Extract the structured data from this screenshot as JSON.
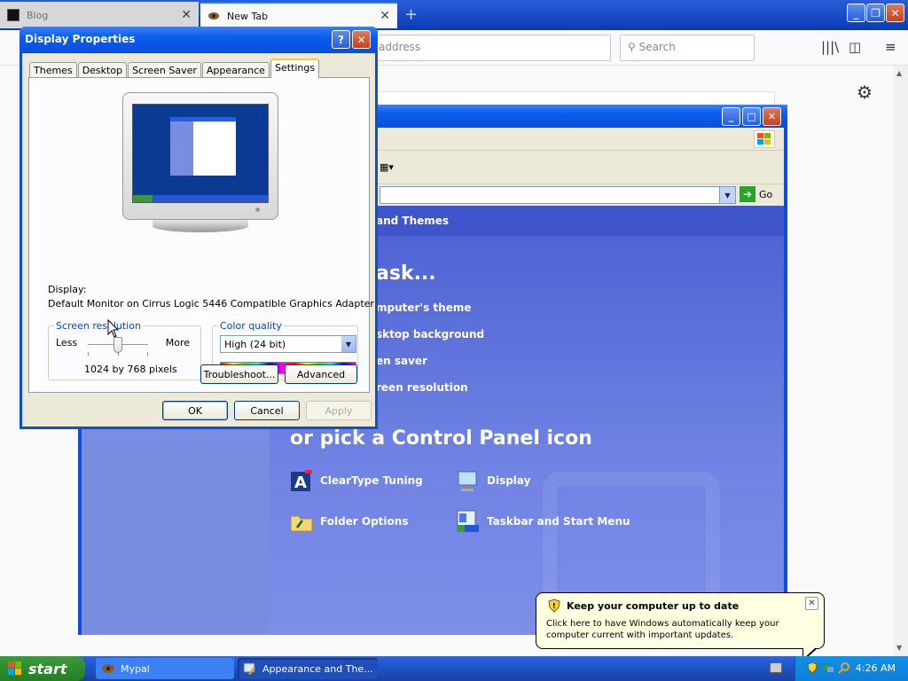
{
  "browser": {
    "tabs": [
      {
        "label": "Blog"
      },
      {
        "label": "New Tab"
      }
    ],
    "url_placeholder": "address",
    "search_placeholder": "Search"
  },
  "control_panel": {
    "breadcrumb": "and Themes",
    "pick_task": "ask...",
    "tasks": [
      {
        "label": "mputer's theme"
      },
      {
        "label": "sktop background"
      },
      {
        "label": "en saver"
      },
      {
        "label": "reen resolution"
      }
    ],
    "pick_icon": "or pick a Control Panel icon",
    "icons": [
      {
        "label": "ClearType Tuning",
        "icon": "cleartype-icon"
      },
      {
        "label": "Display",
        "icon": "display-icon"
      },
      {
        "label": "Folder Options",
        "icon": "folder-options-icon"
      },
      {
        "label": "Taskbar and Start Menu",
        "icon": "taskbar-icon"
      }
    ],
    "go_label": "Go"
  },
  "display_properties": {
    "title": "Display Properties",
    "tabs": [
      "Themes",
      "Desktop",
      "Screen Saver",
      "Appearance",
      "Settings"
    ],
    "active_tab": "Settings",
    "display_label": "Display:",
    "display_value": "Default Monitor on Cirrus Logic 5446 Compatible Graphics Adapter",
    "resolution": {
      "legend": "Screen resolution",
      "less": "Less",
      "more": "More",
      "value": "1024 by 768 pixels",
      "slider_position": 0.5
    },
    "color_quality": {
      "legend": "Color quality",
      "selected": "High (24 bit)"
    },
    "buttons": {
      "troubleshoot": "Troubleshoot...",
      "advanced": "Advanced",
      "ok": "OK",
      "cancel": "Cancel",
      "apply": "Apply"
    }
  },
  "taskbar": {
    "start": "start",
    "items": [
      {
        "label": "Mypal"
      },
      {
        "label": "Appearance and The..."
      }
    ],
    "clock": "4:26 AM"
  },
  "balloon": {
    "title": "Keep your computer up to date",
    "text": "Click here to have Windows automatically keep your computer current with important updates."
  },
  "colors": {
    "xp_blue": "#0b4fd6",
    "cp_body": "#6375d6",
    "taskbar_blue": "#245edb",
    "start_green": "#2f8b2f",
    "balloon_bg": "#ffffe1"
  }
}
